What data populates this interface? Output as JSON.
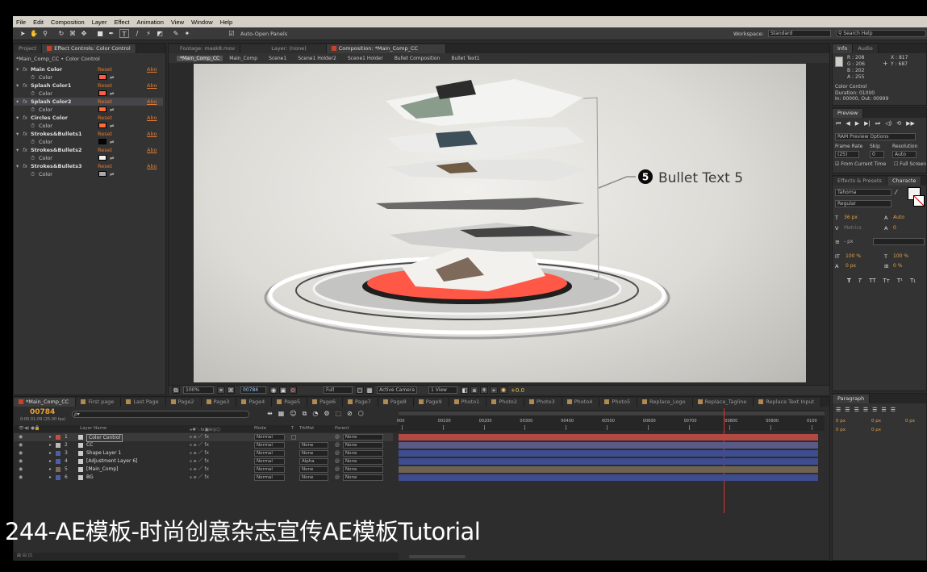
{
  "menu": [
    "File",
    "Edit",
    "Composition",
    "Layer",
    "Effect",
    "Animation",
    "View",
    "Window",
    "Help"
  ],
  "toolbar": {
    "auto_open_label": "Auto-Open Panels",
    "workspace_label": "Workspace:",
    "workspace_value": "Standard",
    "search_placeholder": "Search Help"
  },
  "project_panel": {
    "tabs": [
      "Project",
      "Effect Controls: Color Control"
    ],
    "breadcrumb": "*Main_Comp_CC • Color Control",
    "effects": [
      {
        "name": "Main Color",
        "reset": "Reset",
        "about": "Abo",
        "color_label": "Color",
        "color": "#ff5c45"
      },
      {
        "name": "Splash Color1",
        "reset": "Reset",
        "about": "Abo",
        "color_label": "Color",
        "color": "#ff5c45"
      },
      {
        "name": "Splash Color2",
        "reset": "Reset",
        "about": "Abo",
        "color_label": "Color",
        "color": "#ff6a35"
      },
      {
        "name": "Circles Color",
        "reset": "Reset",
        "about": "Abo",
        "color_label": "Color",
        "color": "#ff6a35"
      },
      {
        "name": "Strokes&Bullets1",
        "reset": "Reset",
        "about": "Abo",
        "color_label": "Color",
        "color": "#050505"
      },
      {
        "name": "Strokes&Bullets2",
        "reset": "Reset",
        "about": "Abo",
        "color_label": "Color",
        "color": "#f2f2f2"
      },
      {
        "name": "Strokes&Bullets3",
        "reset": "Reset",
        "about": "Abo",
        "color_label": "Color",
        "color": "#a9a9a9"
      }
    ]
  },
  "comp_panel": {
    "tabs": [
      "Footage: mask8.mov",
      "Layer: (none)",
      "Composition: *Main_Comp_CC"
    ],
    "breadcrumbs": [
      "*Main_Comp_CC",
      "Main_Comp",
      "Scene1",
      "Scene1 Holder2",
      "Scene1 Holder",
      "Bullet Composition",
      "Bullet Text1"
    ],
    "bullet_number": "5",
    "bullet_text": "Bullet Text 5",
    "footer": {
      "zoom": "100%",
      "timecode": "00784",
      "resolution": "Full",
      "camera": "Active Camera",
      "view": "1 View",
      "exposure": "+0.0"
    }
  },
  "info_panel": {
    "tabs": [
      "Info",
      "Audio"
    ],
    "r": "R : 208",
    "g": "G : 206",
    "b": "B : 202",
    "a": "A : 255",
    "x": "X : 817",
    "y": "Y : 687",
    "lines": [
      "Color Control",
      "Duration: 01000",
      "In: 00000, Out: 00999"
    ]
  },
  "preview_panel": {
    "title": "Preview",
    "ram_options": "RAM Preview Options",
    "frame_rate_label": "Frame Rate",
    "skip_label": "Skip",
    "resolution_label": "Resolution",
    "frame_rate_value": "(25)",
    "skip_value": "0",
    "resolution_value": "Auto",
    "from_current": "From Current Time",
    "full_screen": "Full Screen"
  },
  "character_panel": {
    "tabs": [
      "Effects & Presets",
      "Characte"
    ],
    "font": "Tahoma",
    "style": "Regular",
    "size": "36 px",
    "leading": "Auto",
    "kerning": "Metrics",
    "tracking": "0",
    "stroke": "- px",
    "vscale": "100 %",
    "hscale": "100 %",
    "baseline": "0 px",
    "tsume": "0 %",
    "styles": [
      "T",
      "T",
      "TT",
      "Tт",
      "T¹",
      "T₁"
    ]
  },
  "paragraph_panel": {
    "title": "Paragraph",
    "values": [
      "0 px",
      "0 px",
      "0 px",
      "0 px",
      "0 px"
    ]
  },
  "timeline": {
    "tabs": [
      "*Main_Comp_CC",
      "First page",
      "Last Page",
      "Page2",
      "Page3",
      "Page4",
      "Page5",
      "Page6",
      "Page7",
      "Page8",
      "Page9",
      "Photo1",
      "Photo2",
      "Photo3",
      "Photo4",
      "Photo5",
      "Replace_Logo",
      "Replace_Tagline",
      "Replace Text Input"
    ],
    "timecode": "00784",
    "timecode_sub": "0:00:31:09 (25.00 fps)",
    "search_placeholder": "ρ▾",
    "columns": {
      "layer_name": "Layer Name",
      "mode": "Mode",
      "t": "T",
      "trkmat": "TrkMat",
      "parent": "Parent"
    },
    "ruler": [
      "000",
      "00100",
      "00200",
      "00300",
      "00400",
      "00500",
      "00600",
      "00700",
      "00800",
      "00900",
      "0100"
    ],
    "playhead": 0.785,
    "layers": [
      {
        "num": "1",
        "name": "Color Control",
        "mode": "Normal",
        "trkmat": "",
        "parent": "None",
        "label": "#c94d3d",
        "bar": "#b24a43"
      },
      {
        "num": "2",
        "name": "CC",
        "mode": "Normal",
        "trkmat": "None",
        "parent": "None",
        "label": "#b9b9b9",
        "bar": "#5a5a88"
      },
      {
        "num": "3",
        "name": "Shape Layer 1",
        "mode": "Normal",
        "trkmat": "None",
        "parent": "None",
        "label": "#4c5ea8",
        "bar": "#3d4d8f"
      },
      {
        "num": "4",
        "name": "[Adjustment Layer 6]",
        "mode": "Normal",
        "trkmat": "Alpha",
        "parent": "None",
        "label": "#4c5ea8",
        "bar": "#3d4d8f"
      },
      {
        "num": "5",
        "name": "[Main_Comp]",
        "mode": "Normal",
        "trkmat": "None",
        "parent": "None",
        "label": "#7b6c55",
        "bar": "#6e6350"
      },
      {
        "num": "6",
        "name": "BG",
        "mode": "Normal",
        "trkmat": "None",
        "parent": "None",
        "label": "#4c5ea8",
        "bar": "#3d4d8f"
      }
    ]
  },
  "caption": "244-AE模板-时尚创意杂志宣传AE模板Tutorial"
}
